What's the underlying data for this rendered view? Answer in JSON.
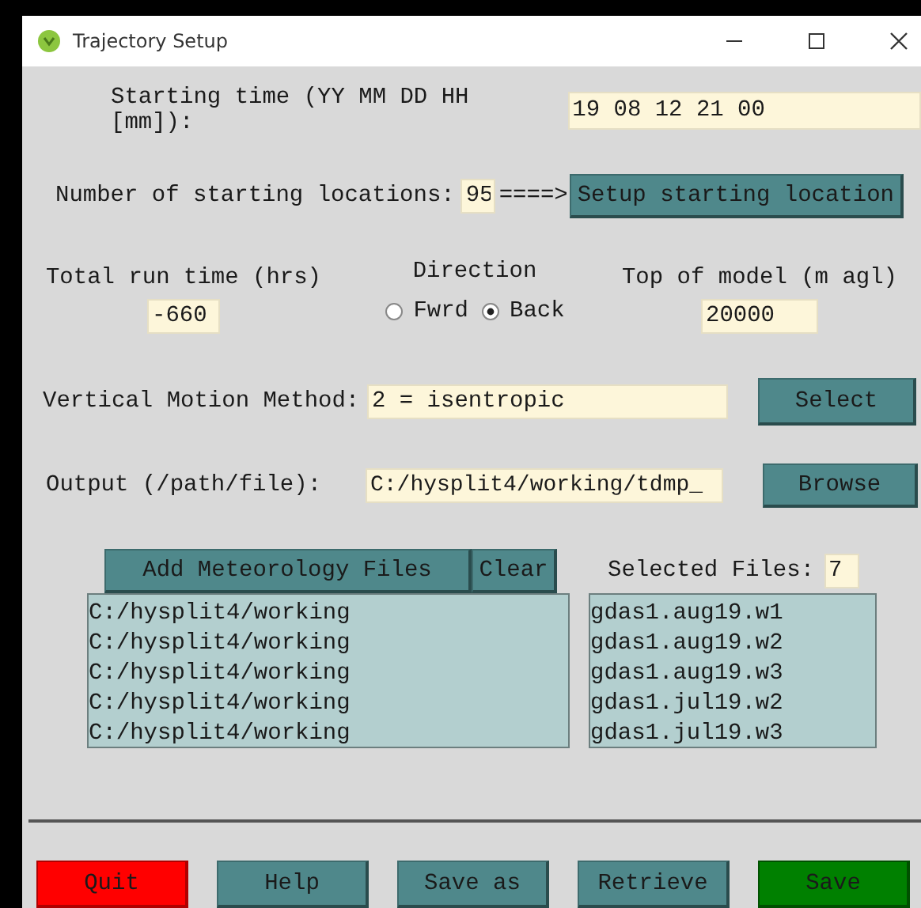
{
  "window": {
    "title": "Trajectory Setup"
  },
  "starting_time": {
    "label": "Starting time (YY MM DD HH [mm]):",
    "value": "19 08 12 21 00"
  },
  "starting_locations": {
    "label": "Number of starting locations:",
    "value": "95",
    "arrow": "====>",
    "button": "Setup starting location"
  },
  "run_time": {
    "label": "Total run time (hrs)",
    "value": "-660"
  },
  "direction": {
    "label": "Direction",
    "options": [
      {
        "label": "Fwrd",
        "selected": false
      },
      {
        "label": "Back",
        "selected": true
      }
    ]
  },
  "top_of_model": {
    "label": "Top of model (m agl)",
    "value": "20000"
  },
  "vertical_motion": {
    "label": "Vertical Motion Method:",
    "value": "2 = isentropic",
    "button": "Select"
  },
  "output": {
    "label": "Output (/path/file):",
    "value": "C:/hysplit4/working/tdmp_",
    "button": "Browse"
  },
  "meteorology": {
    "add_button": "Add Meteorology Files",
    "clear_button": "Clear",
    "directories": [
      "C:/hysplit4/working",
      "C:/hysplit4/working",
      "C:/hysplit4/working",
      "C:/hysplit4/working",
      "C:/hysplit4/working"
    ],
    "selected_label": "Selected Files:",
    "selected_count": "7",
    "files": [
      "gdas1.aug19.w1",
      "gdas1.aug19.w2",
      "gdas1.aug19.w3",
      "gdas1.jul19.w2",
      "gdas1.jul19.w3"
    ]
  },
  "buttons": [
    {
      "label": "Quit",
      "kind": "quit"
    },
    {
      "label": "Help",
      "kind": "normal"
    },
    {
      "label": "Save as",
      "kind": "normal"
    },
    {
      "label": "Retrieve",
      "kind": "normal"
    },
    {
      "label": "Save",
      "kind": "save"
    }
  ]
}
